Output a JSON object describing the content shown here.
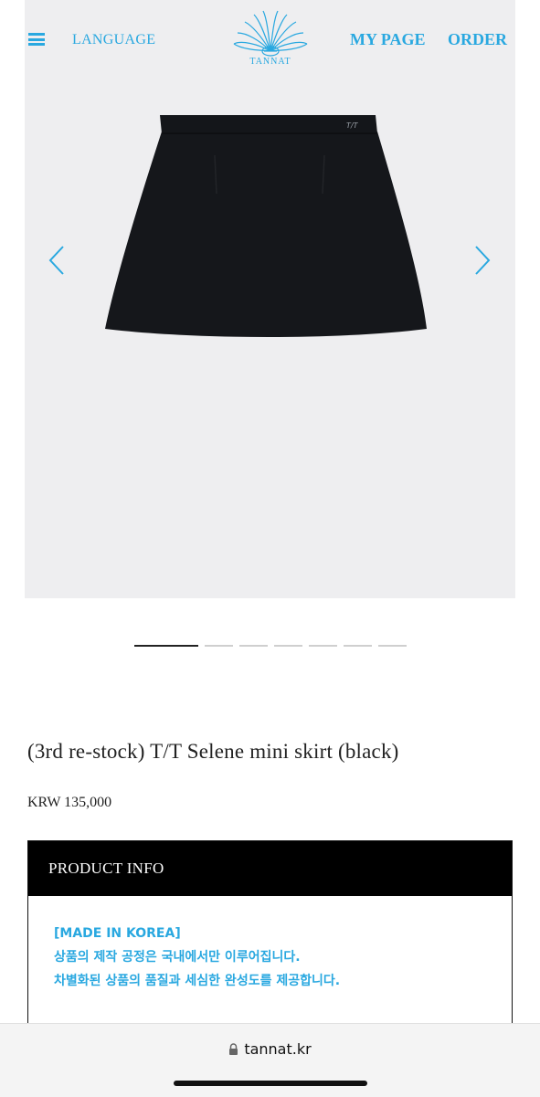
{
  "header": {
    "language_label": "LANGUAGE",
    "brand_name": "TANNAT",
    "mypage_label": "MY PAGE",
    "order_label": "ORDER",
    "accent_color": "#29a8e0"
  },
  "gallery": {
    "image_alt": "black mini skirt",
    "prev_icon": "chevron-left-icon",
    "next_icon": "chevron-right-icon",
    "total_slides": 7,
    "active_slide": 1
  },
  "product": {
    "title": "(3rd re-stock) T/T Selene mini skirt (black)",
    "price": "KRW 135,000"
  },
  "info": {
    "heading": "PRODUCT INFO",
    "lines": [
      "[MADE IN KOREA]",
      "상품의 제작 공정은 국내에서만 이루어집니다.",
      "차별화된 상품의 품질과 세심한 완성도를 제공합니다."
    ]
  },
  "browser": {
    "url": "tannat.kr"
  }
}
